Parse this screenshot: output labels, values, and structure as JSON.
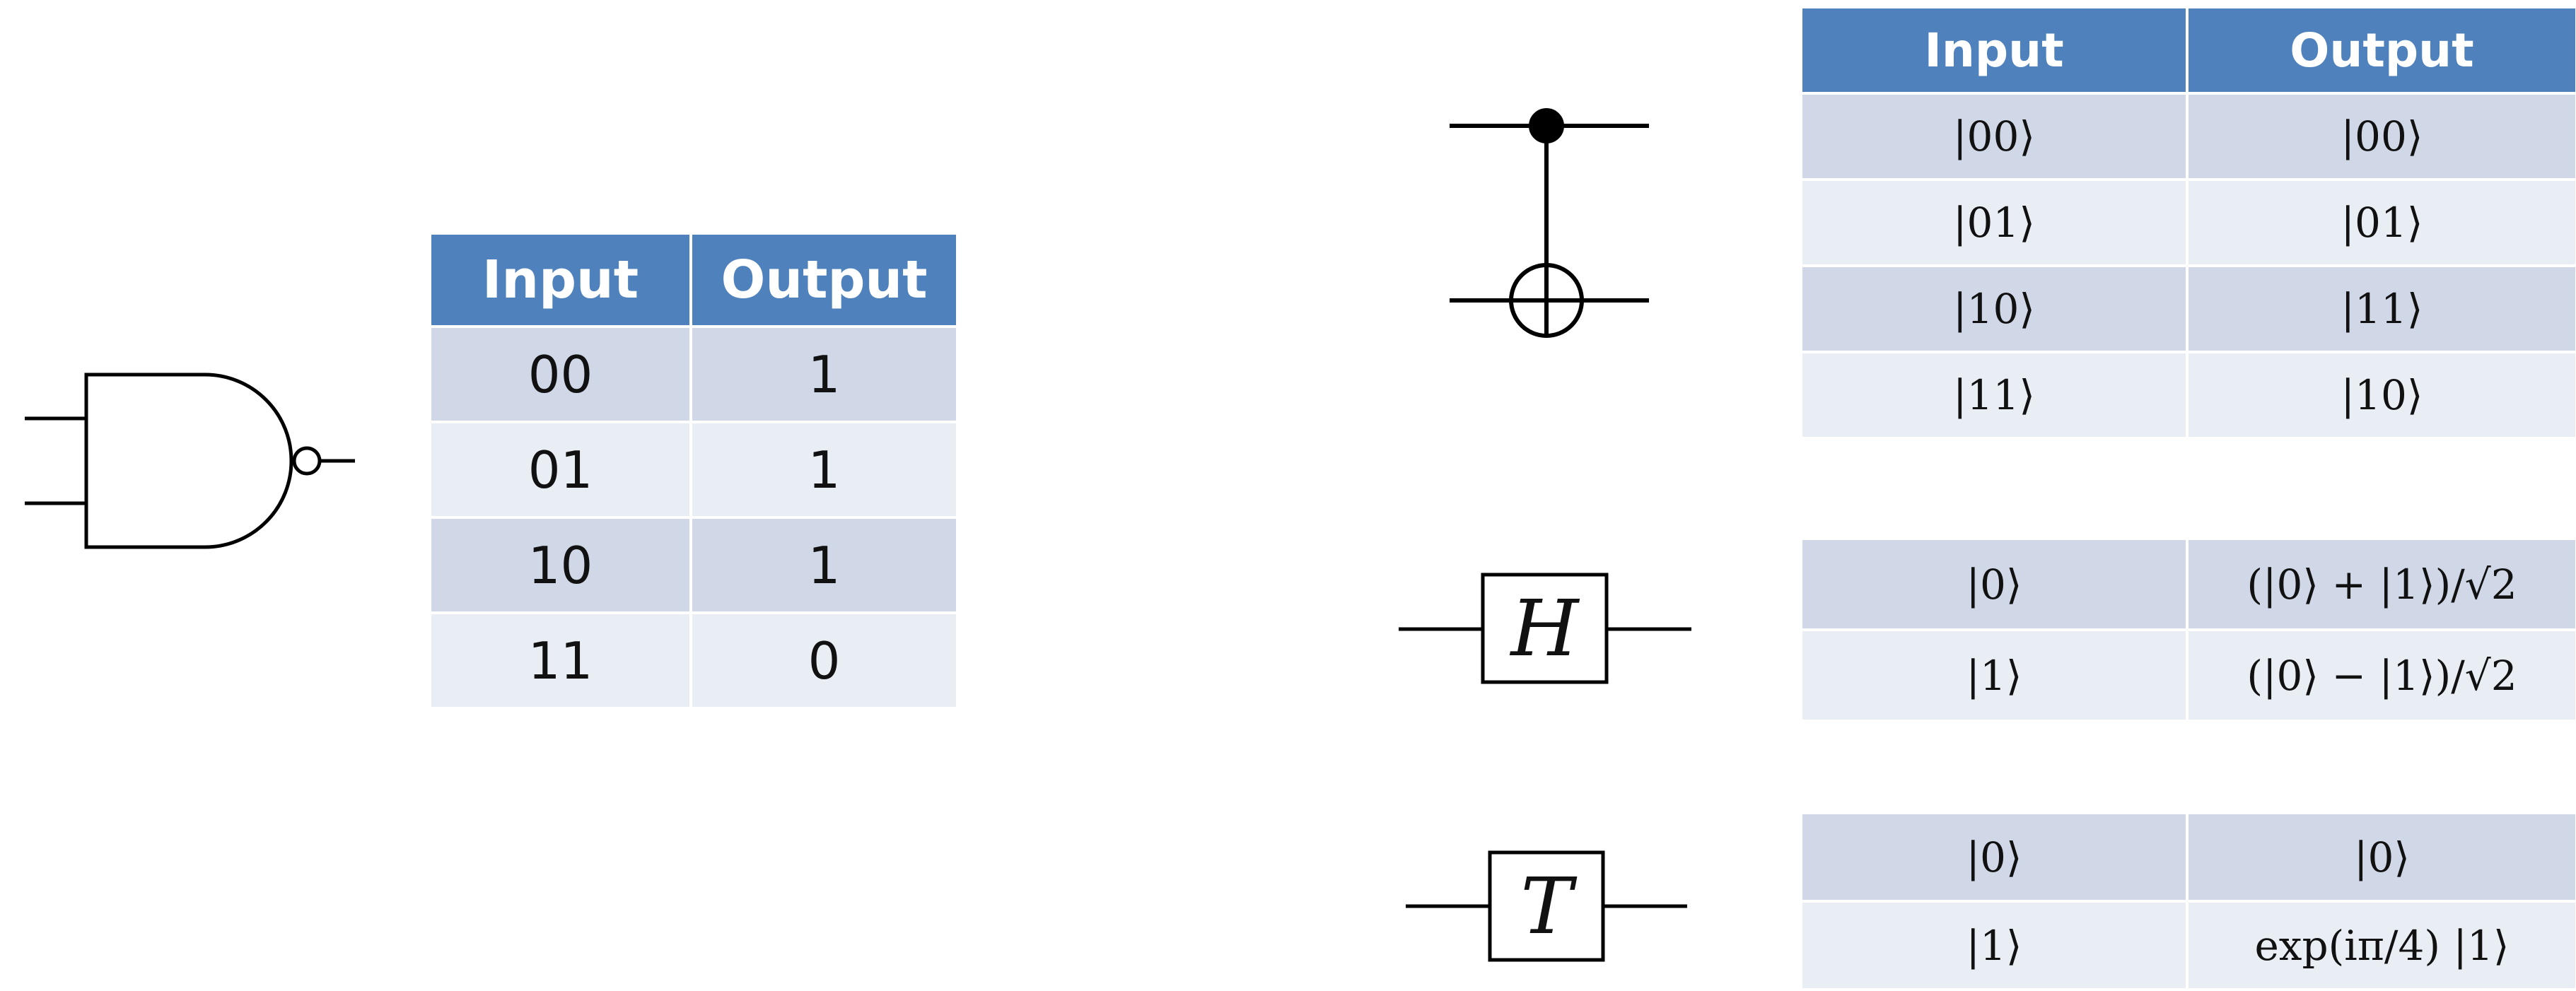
{
  "nand_table": {
    "headers": [
      "Input",
      "Output"
    ],
    "rows": [
      [
        "00",
        "1"
      ],
      [
        "01",
        "1"
      ],
      [
        "10",
        "1"
      ],
      [
        "11",
        "0"
      ]
    ]
  },
  "cnot_table": {
    "headers": [
      "Input",
      "Output"
    ],
    "rows": [
      [
        "|00⟩",
        "|00⟩"
      ],
      [
        "|01⟩",
        "|01⟩"
      ],
      [
        "|10⟩",
        "|11⟩"
      ],
      [
        "|11⟩",
        "|10⟩"
      ]
    ]
  },
  "hadamard_gate": {
    "label": "H",
    "rows": [
      [
        "|0⟩",
        "(|0⟩ + |1⟩)/√2"
      ],
      [
        "|1⟩",
        "(|0⟩ − |1⟩)/√2"
      ]
    ]
  },
  "t_gate": {
    "label": "T",
    "rows": [
      [
        "|0⟩",
        "|0⟩"
      ],
      [
        "|1⟩",
        "exp(iπ/4) |1⟩"
      ]
    ]
  }
}
